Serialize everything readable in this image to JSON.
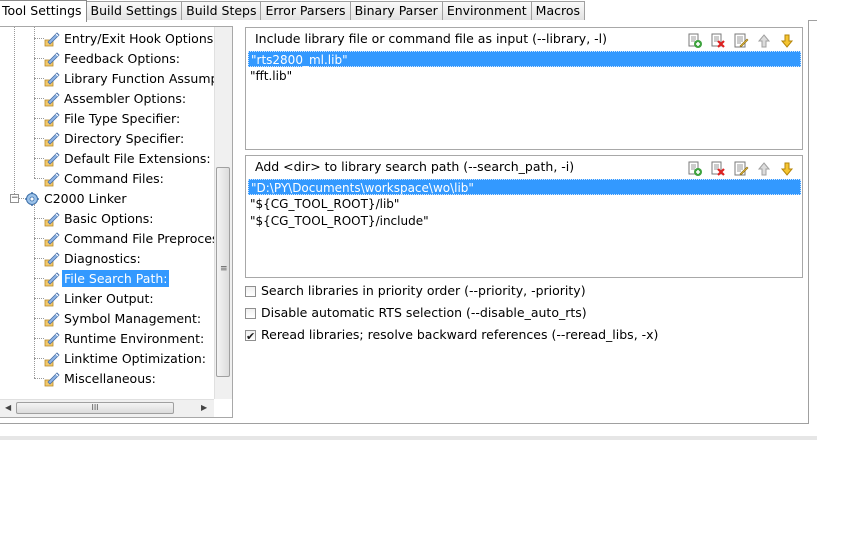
{
  "tabs": [
    {
      "label": "Tool Settings",
      "active": true
    },
    {
      "label": "Build Settings",
      "active": false
    },
    {
      "label": "Build Steps",
      "active": false
    },
    {
      "label": "Error Parsers",
      "active": false
    },
    {
      "label": "Binary Parser",
      "active": false
    },
    {
      "label": "Environment",
      "active": false
    },
    {
      "label": "Macros",
      "active": false
    }
  ],
  "tree": {
    "compiler_items": [
      "Entry/Exit Hook Options:",
      "Feedback Options:",
      "Library Function Assumpti",
      "Assembler Options:",
      "File Type Specifier:",
      "Directory Specifier:",
      "Default File Extensions:",
      "Command Files:"
    ],
    "linker_label": "C2000 Linker",
    "linker_items": [
      "Basic Options:",
      "Command File Preprocess",
      "Diagnostics:",
      "File Search Path:",
      "Linker Output:",
      "Symbol Management:",
      "Runtime Environment:",
      "Linktime Optimization:",
      "Miscellaneous:"
    ],
    "selected": "File Search Path:",
    "expander_symbol": "−",
    "hscroll_grip": "III",
    "vscroll_grip": "≡"
  },
  "library_list": {
    "header": "Include library file or command file as input (--library, -l)",
    "items": [
      "\"rts2800_ml.lib\"",
      "\"fft.lib\""
    ],
    "selected_index": 0
  },
  "search_path_list": {
    "header": "Add <dir> to library search path (--search_path, -i)",
    "items": [
      "\"D:\\PY\\Documents\\workspace\\wo\\lib\"",
      "\"${CG_TOOL_ROOT}/lib\"",
      "\"${CG_TOOL_ROOT}/include\""
    ],
    "selected_index": 0
  },
  "options": [
    {
      "label": "Search libraries in priority order (--priority, -priority)",
      "checked": false
    },
    {
      "label": "Disable automatic RTS selection (--disable_auto_rts)",
      "checked": false
    },
    {
      "label": "Reread libraries; resolve backward references (--reread_libs, -x)",
      "checked": true
    }
  ],
  "toolbar_icons": [
    "add-icon",
    "delete-icon",
    "edit-icon",
    "move-up-icon",
    "move-down-icon"
  ],
  "colors": {
    "selection": "#3399ff",
    "border": "#a8a8a8"
  }
}
